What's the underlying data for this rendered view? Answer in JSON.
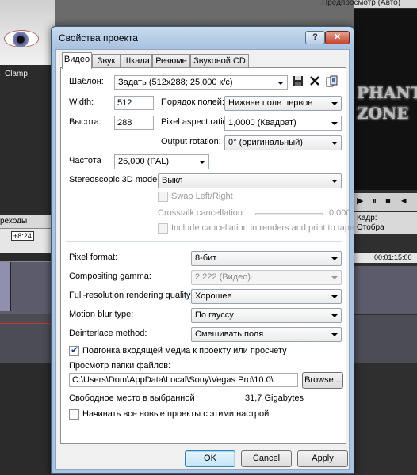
{
  "background": {
    "thumb_label": "Clamp",
    "tab_label": "реходы",
    "marker": "+8:24",
    "preview_title": "Предпросмотр (Авто)",
    "video_text_line1": "PHANTOM",
    "video_text_line2": "ZONE",
    "controls": "▶ ⏸ ■ ◄",
    "frame_label": "Кадр:",
    "display_label": "Отобра",
    "timecode": "00:01:15;00"
  },
  "dialog": {
    "title": "Свойства проекта",
    "help_label": "?",
    "close_label": "✕",
    "tabs": [
      "Видео",
      "Звук",
      "Шкала",
      "Резюме",
      "Звуковой CD"
    ],
    "template": {
      "label": "Шаблон:",
      "value": "Задать (512x288; 25,000 к/с)"
    },
    "width": {
      "label": "Width:",
      "value": "512"
    },
    "height": {
      "label": "Высота:",
      "value": "288"
    },
    "field_order": {
      "label": "Порядок полей:",
      "value": "Нижнее поле первое"
    },
    "pixel_aspect": {
      "label": "Pixel aspect ratio:",
      "value": "1,0000 (Квадрат)"
    },
    "output_rotation": {
      "label": "Output rotation:",
      "value": "0° (оригинальный)"
    },
    "frame_rate": {
      "label": "Частота",
      "value": "25,000 (PAL)"
    },
    "stereo_3d": {
      "label": "Stereoscopic 3D mode:",
      "value": "Выкл"
    },
    "swap_lr": {
      "label": "Swap Left/Right",
      "checked": false
    },
    "crosstalk": {
      "label": "Crosstalk cancellation:",
      "value": "0,000"
    },
    "include_cancellation": {
      "label": "Include cancellation in renders and print to tape",
      "checked": false
    },
    "pixel_format": {
      "label": "Pixel format:",
      "value": "8-бит"
    },
    "compositing_gamma": {
      "label": "Compositing gamma:",
      "value": "2,222 (Видео)"
    },
    "render_quality": {
      "label": "Full-resolution rendering quality:",
      "value": "Хорошее"
    },
    "motion_blur": {
      "label": "Motion blur type:",
      "value": "По гауссу"
    },
    "deinterlace": {
      "label": "Deinterlace method:",
      "value": "Смешивать поля"
    },
    "adapt_media": {
      "label": "Подгонка входящей медиа к проекту или просчету",
      "checked": true
    },
    "folder": {
      "label": "Просмотр папки файлов:",
      "value": "C:\\Users\\Dom\\AppData\\Local\\Sony\\Vegas Pro\\10.0\\",
      "browse": "Browse..."
    },
    "free_space": {
      "label": "Свободное место в выбранной",
      "value": "31,7 Gigabytes"
    },
    "start_new": {
      "label": "Начинать все новые проекты с этими настрой",
      "checked": false
    },
    "buttons": {
      "ok": "OK",
      "cancel": "Cancel",
      "apply": "Apply"
    }
  }
}
